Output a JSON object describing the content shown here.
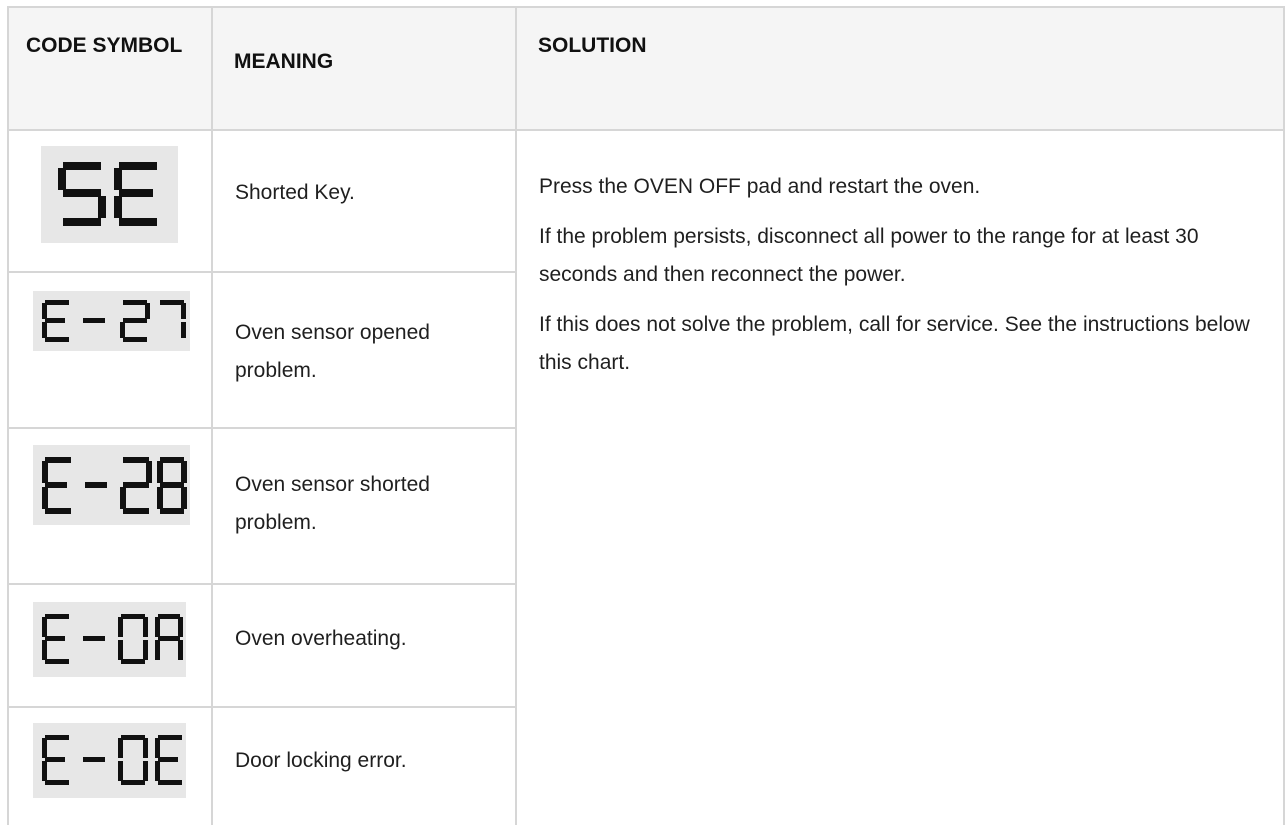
{
  "header": {
    "code_symbol": "CODE SYMBOL",
    "meaning": "MEANING",
    "solution": "SOLUTION"
  },
  "rows": [
    {
      "code": "SE",
      "meaning": "Shorted Key."
    },
    {
      "code": "E-27",
      "meaning": "Oven sensor opened problem."
    },
    {
      "code": "E-28",
      "meaning": "Oven sensor shorted problem."
    },
    {
      "code": "E-0A",
      "meaning": "Oven overheating."
    },
    {
      "code": "E-0E",
      "meaning": "Door locking error."
    }
  ],
  "solution": {
    "p1": "Press the OVEN OFF pad and restart the oven.",
    "p2": "If the problem persists, disconnect all power to the range for at least 30 seconds and then reconnect the power.",
    "p3": "If this does not solve the problem, call for service. See the instructions below this chart."
  },
  "colors": {
    "border": "#d6d6d6",
    "header_bg": "#f5f5f5",
    "display_bg": "#e7e7e7",
    "segment": "#111111"
  }
}
